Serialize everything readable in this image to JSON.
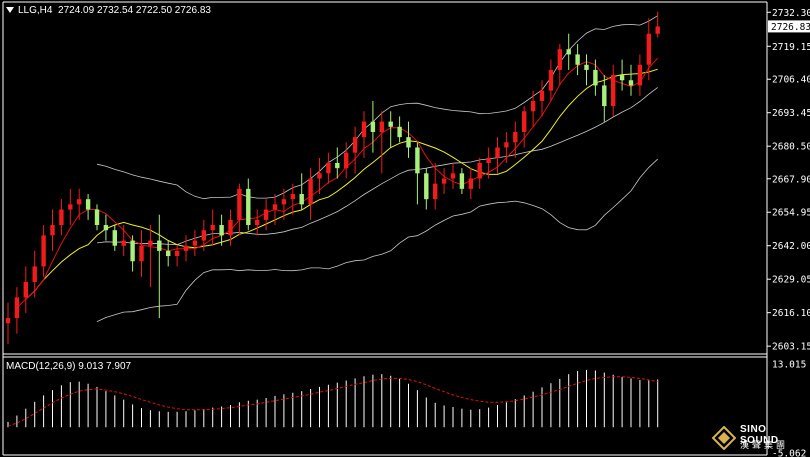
{
  "header": {
    "symbol": "LLG,H4",
    "ohlc": "2724.09 2732.54 2722.50 2726.83"
  },
  "macd": {
    "label": "MACD(12,26,9) 9.013 7.907"
  },
  "logo": {
    "line1": "SINO SOUND",
    "line2": "漢聲集團"
  },
  "colors": {
    "background": "#000000",
    "up_candle": "#f21b1b",
    "down_candle": "#a8f07a",
    "bollinger": "#c8c8c8",
    "ma_fast": "#e01010",
    "ma_slow": "#f0f020",
    "macd_hist": "#ffffff",
    "macd_signal": "#e01010",
    "price_tag_bg": "#ffffff"
  },
  "chart_data": [
    {
      "type": "candlestick",
      "symbol": "LLG",
      "timeframe": "H4",
      "ylim": [
        2600.5,
        2735.5
      ],
      "yticks": [
        "2732.30",
        "2719.15",
        "2706.40",
        "2693.45",
        "2680.50",
        "2667.90",
        "2654.95",
        "2642.00",
        "2629.05",
        "2616.10",
        "2603.15"
      ],
      "current_price": "2726.83",
      "candles": [
        [
          2612,
          2620,
          2604,
          2614
        ],
        [
          2614,
          2626,
          2608,
          2622
        ],
        [
          2622,
          2634,
          2616,
          2628
        ],
        [
          2628,
          2640,
          2622,
          2634
        ],
        [
          2634,
          2650,
          2630,
          2646
        ],
        [
          2646,
          2656,
          2640,
          2650
        ],
        [
          2650,
          2660,
          2646,
          2656
        ],
        [
          2656,
          2664,
          2650,
          2658
        ],
        [
          2658,
          2664,
          2652,
          2660
        ],
        [
          2660,
          2662,
          2652,
          2656
        ],
        [
          2656,
          2658,
          2648,
          2650
        ],
        [
          2650,
          2654,
          2644,
          2648
        ],
        [
          2648,
          2650,
          2640,
          2642
        ],
        [
          2642,
          2650,
          2638,
          2644
        ],
        [
          2644,
          2646,
          2632,
          2636
        ],
        [
          2636,
          2648,
          2630,
          2642
        ],
        [
          2642,
          2650,
          2626,
          2644
        ],
        [
          2644,
          2654,
          2614,
          2640
        ],
        [
          2640,
          2644,
          2634,
          2638
        ],
        [
          2638,
          2642,
          2634,
          2640
        ],
        [
          2640,
          2646,
          2636,
          2642
        ],
        [
          2642,
          2648,
          2638,
          2644
        ],
        [
          2644,
          2652,
          2640,
          2648
        ],
        [
          2648,
          2656,
          2642,
          2650
        ],
        [
          2650,
          2654,
          2642,
          2646
        ],
        [
          2646,
          2656,
          2642,
          2652
        ],
        [
          2652,
          2666,
          2646,
          2664
        ],
        [
          2664,
          2668,
          2648,
          2650
        ],
        [
          2650,
          2656,
          2646,
          2652
        ],
        [
          2652,
          2660,
          2648,
          2656
        ],
        [
          2656,
          2662,
          2650,
          2658
        ],
        [
          2658,
          2664,
          2652,
          2660
        ],
        [
          2660,
          2666,
          2654,
          2662
        ],
        [
          2662,
          2670,
          2656,
          2658
        ],
        [
          2658,
          2672,
          2652,
          2668
        ],
        [
          2668,
          2676,
          2662,
          2670
        ],
        [
          2670,
          2678,
          2666,
          2674
        ],
        [
          2674,
          2680,
          2668,
          2672
        ],
        [
          2672,
          2682,
          2668,
          2678
        ],
        [
          2678,
          2688,
          2670,
          2684
        ],
        [
          2684,
          2694,
          2676,
          2690
        ],
        [
          2690,
          2698,
          2678,
          2686
        ],
        [
          2686,
          2694,
          2670,
          2690
        ],
        [
          2690,
          2694,
          2680,
          2688
        ],
        [
          2688,
          2692,
          2682,
          2684
        ],
        [
          2684,
          2690,
          2676,
          2680
        ],
        [
          2680,
          2682,
          2658,
          2670
        ],
        [
          2670,
          2672,
          2656,
          2660
        ],
        [
          2660,
          2674,
          2656,
          2666
        ],
        [
          2666,
          2672,
          2662,
          2668
        ],
        [
          2668,
          2674,
          2664,
          2670
        ],
        [
          2670,
          2672,
          2662,
          2664
        ],
        [
          2664,
          2672,
          2660,
          2668
        ],
        [
          2668,
          2676,
          2664,
          2674
        ],
        [
          2674,
          2680,
          2668,
          2676
        ],
        [
          2676,
          2684,
          2670,
          2680
        ],
        [
          2680,
          2686,
          2674,
          2682
        ],
        [
          2682,
          2690,
          2676,
          2686
        ],
        [
          2686,
          2696,
          2680,
          2694
        ],
        [
          2694,
          2702,
          2688,
          2698
        ],
        [
          2698,
          2706,
          2692,
          2702
        ],
        [
          2702,
          2714,
          2698,
          2710
        ],
        [
          2710,
          2720,
          2704,
          2718
        ],
        [
          2718,
          2724,
          2710,
          2716
        ],
        [
          2716,
          2720,
          2708,
          2712
        ],
        [
          2712,
          2716,
          2704,
          2710
        ],
        [
          2710,
          2714,
          2700,
          2704
        ],
        [
          2704,
          2708,
          2690,
          2696
        ],
        [
          2696,
          2712,
          2692,
          2708
        ],
        [
          2708,
          2714,
          2702,
          2706
        ],
        [
          2706,
          2712,
          2700,
          2704
        ],
        [
          2704,
          2716,
          2700,
          2712
        ],
        [
          2712,
          2730,
          2706,
          2724
        ],
        [
          2724,
          2732.54,
          2722.5,
          2726.83
        ]
      ]
    },
    {
      "type": "bar",
      "indicator": "MACD",
      "params": "12,26,9",
      "macd": 9.013,
      "signal": 7.907,
      "ylim": [
        -5.05,
        13.05
      ],
      "yticks": [
        "13.015",
        "-5.062"
      ],
      "histogram": [
        1.0,
        2.2,
        3.5,
        4.8,
        6.0,
        7.0,
        7.9,
        8.5,
        8.6,
        8.2,
        7.6,
        6.8,
        6.0,
        5.2,
        4.3,
        3.6,
        3.2,
        3.0,
        2.9,
        2.9,
        3.0,
        3.2,
        3.4,
        3.7,
        3.9,
        4.2,
        4.7,
        5.0,
        5.2,
        5.5,
        5.9,
        6.2,
        6.5,
        6.8,
        7.2,
        7.6,
        8.0,
        8.4,
        8.8,
        9.2,
        9.6,
        9.9,
        10.0,
        9.7,
        9.1,
        8.2,
        7.0,
        5.6,
        4.6,
        4.1,
        3.8,
        3.5,
        3.3,
        3.4,
        3.7,
        4.2,
        4.7,
        5.3,
        6.0,
        6.7,
        7.5,
        8.3,
        9.1,
        10.0,
        10.6,
        10.8,
        10.7,
        10.3,
        9.9,
        9.5,
        9.2,
        8.9,
        8.8,
        9.0
      ],
      "signal_line": [
        0.2,
        0.8,
        1.6,
        2.6,
        3.6,
        4.6,
        5.5,
        6.2,
        6.8,
        7.1,
        7.2,
        7.0,
        6.7,
        6.3,
        5.8,
        5.2,
        4.7,
        4.2,
        3.8,
        3.5,
        3.3,
        3.3,
        3.3,
        3.4,
        3.5,
        3.7,
        3.9,
        4.2,
        4.4,
        4.7,
        5.0,
        5.3,
        5.6,
        5.9,
        6.2,
        6.6,
        6.9,
        7.3,
        7.7,
        8.1,
        8.4,
        8.8,
        9.1,
        9.2,
        9.2,
        9.0,
        8.6,
        8.0,
        7.3,
        6.7,
        6.1,
        5.6,
        5.2,
        4.9,
        4.7,
        4.7,
        4.8,
        5.0,
        5.3,
        5.7,
        6.1,
        6.6,
        7.1,
        7.7,
        8.3,
        8.8,
        9.2,
        9.4,
        9.5,
        9.5,
        9.4,
        9.2,
        8.9,
        8.6
      ]
    }
  ]
}
